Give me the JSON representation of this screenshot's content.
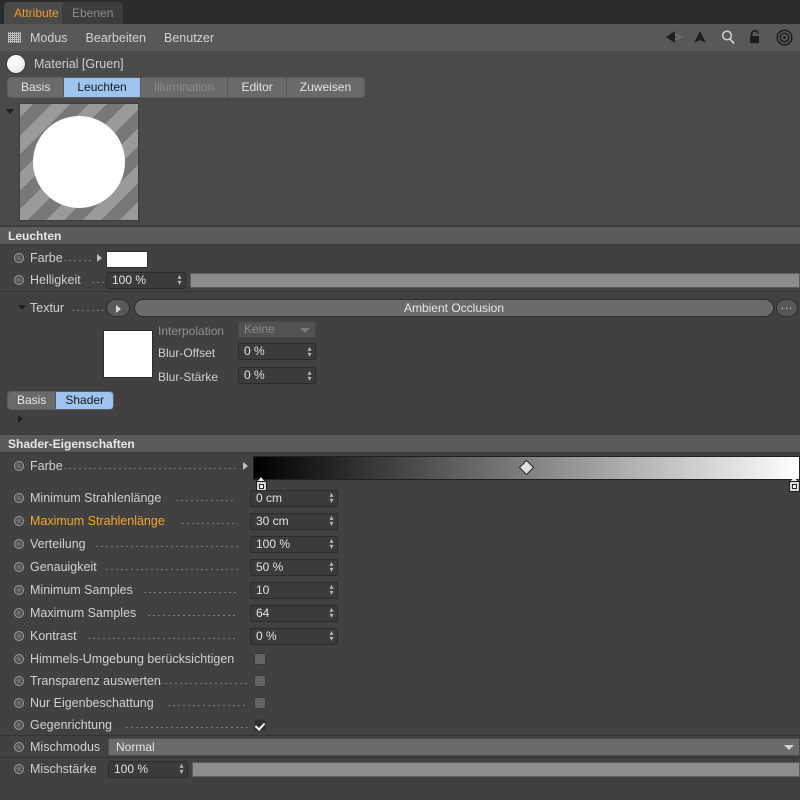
{
  "window_tabs": [
    {
      "label": "Attribute",
      "active": true
    },
    {
      "label": "Ebenen",
      "active": false
    }
  ],
  "menubar": {
    "grid_icon": "grid-icon",
    "items": [
      "Modus",
      "Bearbeiten",
      "Benutzer"
    ],
    "icons": [
      "back-arrow-icon",
      "up-arrow-icon",
      "search-icon",
      "lock-icon",
      "target-icon"
    ]
  },
  "material": {
    "title": "Material [Gruen]",
    "ball_icon": "material-sphere-icon"
  },
  "main_tabs": [
    {
      "label": "Basis",
      "state": "normal"
    },
    {
      "label": "Leuchten",
      "state": "selected"
    },
    {
      "label": "Illumination",
      "state": "dimmed"
    },
    {
      "label": "Editor",
      "state": "normal"
    },
    {
      "label": "Zuweisen",
      "state": "normal"
    }
  ],
  "sections": {
    "leuchten": {
      "header": "Leuchten",
      "farbe": {
        "label": "Farbe",
        "color": "#ffffff"
      },
      "helligkeit": {
        "label": "Helligkeit",
        "value": "100 %"
      },
      "textur": {
        "label": "Textur",
        "value": "Ambient Occlusion",
        "more_button": "...",
        "interpolation": {
          "label": "Interpolation",
          "value": "Keine"
        },
        "blur_offset": {
          "label": "Blur-Offset",
          "value": "0 %"
        },
        "blur_staerke": {
          "label": "Blur-Stärke",
          "value": "0 %"
        }
      }
    },
    "sub_tabs": [
      {
        "label": "Basis",
        "selected": false
      },
      {
        "label": "Shader",
        "selected": true
      }
    ],
    "shader": {
      "header": "Shader-Eigenschaften",
      "farbe": {
        "label": "Farbe",
        "gradient_from": "#000000",
        "gradient_to": "#ffffff"
      },
      "params": [
        {
          "label": "Minimum Strahlenlänge",
          "value": "0 cm",
          "highlight": false
        },
        {
          "label": "Maximum Strahlenlänge",
          "value": "30 cm",
          "highlight": true
        },
        {
          "label": "Verteilung",
          "value": "100 %",
          "highlight": false
        },
        {
          "label": "Genauigkeit",
          "value": "50 %",
          "highlight": false
        },
        {
          "label": "Minimum Samples",
          "value": "10",
          "highlight": false
        },
        {
          "label": "Maximum Samples",
          "value": "64",
          "highlight": false
        },
        {
          "label": "Kontrast",
          "value": "0 %",
          "highlight": false
        }
      ],
      "checkboxes": [
        {
          "label": "Himmels-Umgebung berücksichtigen",
          "checked": false
        },
        {
          "label": "Transparenz auswerten",
          "checked": false
        },
        {
          "label": "Nur Eigenbeschattung",
          "checked": false
        },
        {
          "label": "Gegenrichtung",
          "checked": true
        }
      ],
      "mischmodus": {
        "label": "Mischmodus",
        "value": "Normal"
      },
      "mischstaerke": {
        "label": "Mischstärke",
        "value": "100 %"
      }
    }
  },
  "colors": {
    "accent_orange": "#f29b2a",
    "tab_selected_blue": "#9dc4ef",
    "panel_bg": "#4a4a4a",
    "menubar_bg": "#585858"
  }
}
